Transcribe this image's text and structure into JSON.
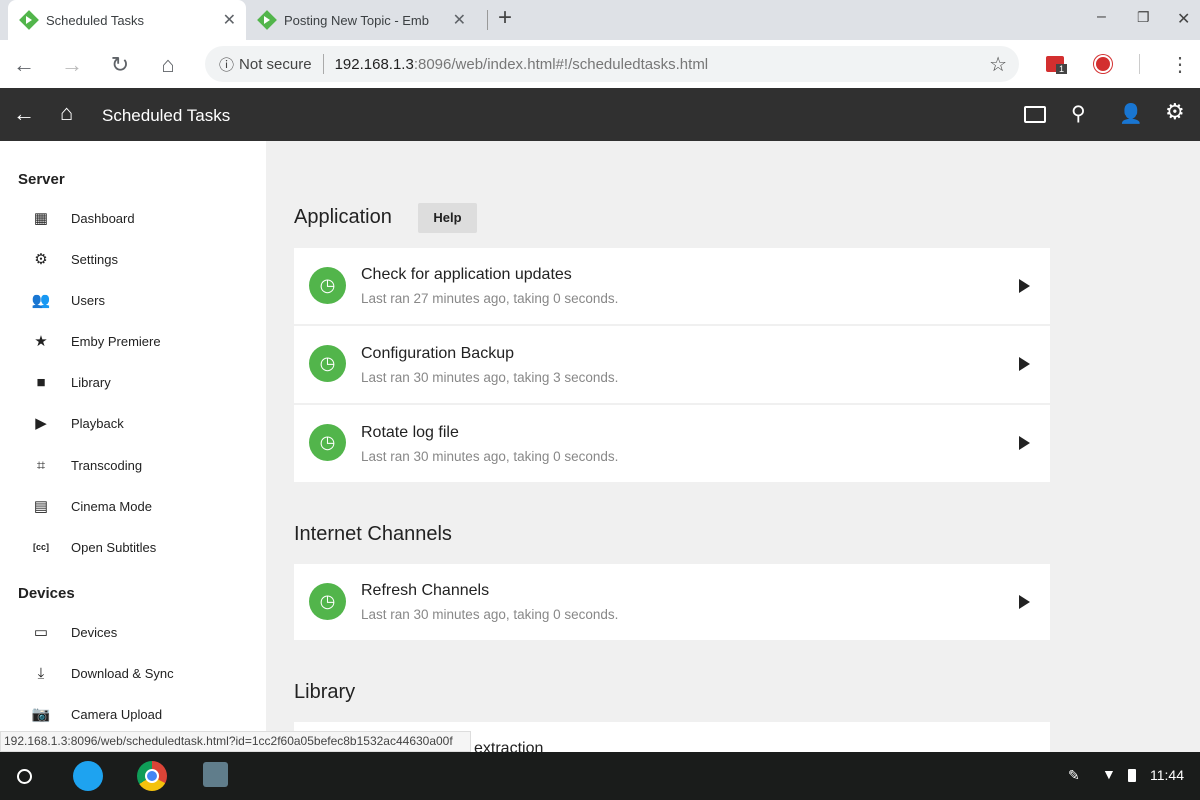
{
  "browser": {
    "tabs": [
      {
        "title": "Scheduled Tasks"
      },
      {
        "title": "Posting New Topic - Emby Cor"
      }
    ],
    "security": "Not secure",
    "url_host": "192.168.1.3",
    "url_rest": ":8096/web/index.html#!/scheduledtasks.html",
    "ext_badge": "1",
    "status_url": "192.168.1.3:8096/web/scheduledtask.html?id=1cc2f60a05befec8b1532ac44630a00f"
  },
  "header": {
    "title": "Scheduled Tasks"
  },
  "sidebar": {
    "sections": [
      {
        "title": "Server",
        "items": [
          "Dashboard",
          "Settings",
          "Users",
          "Emby Premiere",
          "Library",
          "Playback",
          "Transcoding",
          "Cinema Mode",
          "Open Subtitles"
        ]
      },
      {
        "title": "Devices",
        "items": [
          "Devices",
          "Download & Sync",
          "Camera Upload"
        ]
      }
    ]
  },
  "main": {
    "help_label": "Help",
    "sections": [
      {
        "title": "Application",
        "tasks": [
          {
            "name": "Check for application updates",
            "status": "Last ran 27 minutes ago, taking 0 seconds."
          },
          {
            "name": "Configuration Backup",
            "status": "Last ran 30 minutes ago, taking 3 seconds."
          },
          {
            "name": "Rotate log file",
            "status": "Last ran 30 minutes ago, taking 0 seconds."
          }
        ]
      },
      {
        "title": "Internet Channels",
        "tasks": [
          {
            "name": "Refresh Channels",
            "status": "Last ran 30 minutes ago, taking 0 seconds."
          }
        ]
      },
      {
        "title": "Library",
        "tasks": [
          {
            "name": "extraction"
          }
        ]
      }
    ]
  },
  "taskbar": {
    "time": "11:44"
  },
  "colors": {
    "accent": "#52b54b",
    "header": "#303030"
  }
}
